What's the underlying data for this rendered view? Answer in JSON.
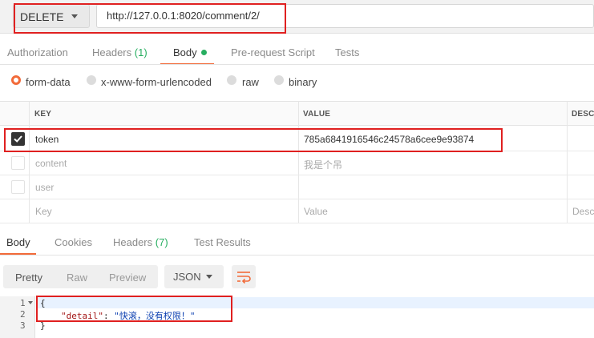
{
  "request": {
    "method": "DELETE",
    "url": "http://127.0.0.1:8020/comment/2/"
  },
  "tabs": [
    {
      "label": "Authorization"
    },
    {
      "label": "Headers",
      "count": "(1)"
    },
    {
      "label": "Body"
    },
    {
      "label": "Pre-request Script"
    },
    {
      "label": "Tests"
    }
  ],
  "body_types": [
    "form-data",
    "x-www-form-urlencoded",
    "raw",
    "binary"
  ],
  "selected_body_type": "form-data",
  "table": {
    "headers": [
      "KEY",
      "VALUE",
      "DESCR"
    ],
    "rows": [
      {
        "checked": true,
        "key": "token",
        "value": "785a6841916546c24578a6cee9e93874"
      },
      {
        "checked": false,
        "key": "content",
        "value": "我是个吊"
      },
      {
        "checked": false,
        "key": "user",
        "value": ""
      }
    ],
    "placeholder": {
      "key": "Key",
      "value": "Value",
      "descr": "Desc"
    }
  },
  "response_tabs": [
    {
      "label": "Body"
    },
    {
      "label": "Cookies"
    },
    {
      "label": "Headers",
      "count": "(7)"
    },
    {
      "label": "Test Results"
    }
  ],
  "view_buttons": [
    "Pretty",
    "Raw",
    "Preview"
  ],
  "format": "JSON",
  "code": {
    "line_numbers": [
      "1",
      "2",
      "3"
    ],
    "open": "{",
    "key": "\"detail\"",
    "colon": ": ",
    "value": "\"快滚，没有权限！\"",
    "close": "}"
  },
  "colors": {
    "accent": "#f26b3a",
    "highlight_box": "#e02020",
    "indicator": "#27ae60"
  }
}
